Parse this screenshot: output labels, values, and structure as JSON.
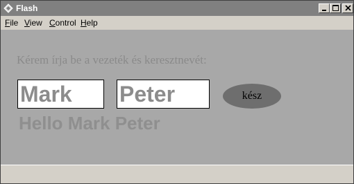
{
  "window": {
    "title": "Flash"
  },
  "menu": {
    "file": {
      "underline": "F",
      "rest": "ile"
    },
    "view": {
      "underline": "V",
      "rest": "iew"
    },
    "control": {
      "underline": "C",
      "rest": "ontrol"
    },
    "help": {
      "underline": "H",
      "rest": "elp"
    }
  },
  "form": {
    "prompt": "Kérem írja be a vezeték és keresztnevét:",
    "first_name": "Mark",
    "last_name": "Peter",
    "done_label": "kész",
    "greeting": "Hello Mark Peter"
  },
  "icons": {
    "app": "flash-diamond-icon",
    "minimize": "minimize-icon",
    "maximize": "maximize-icon",
    "close": "close-icon"
  }
}
